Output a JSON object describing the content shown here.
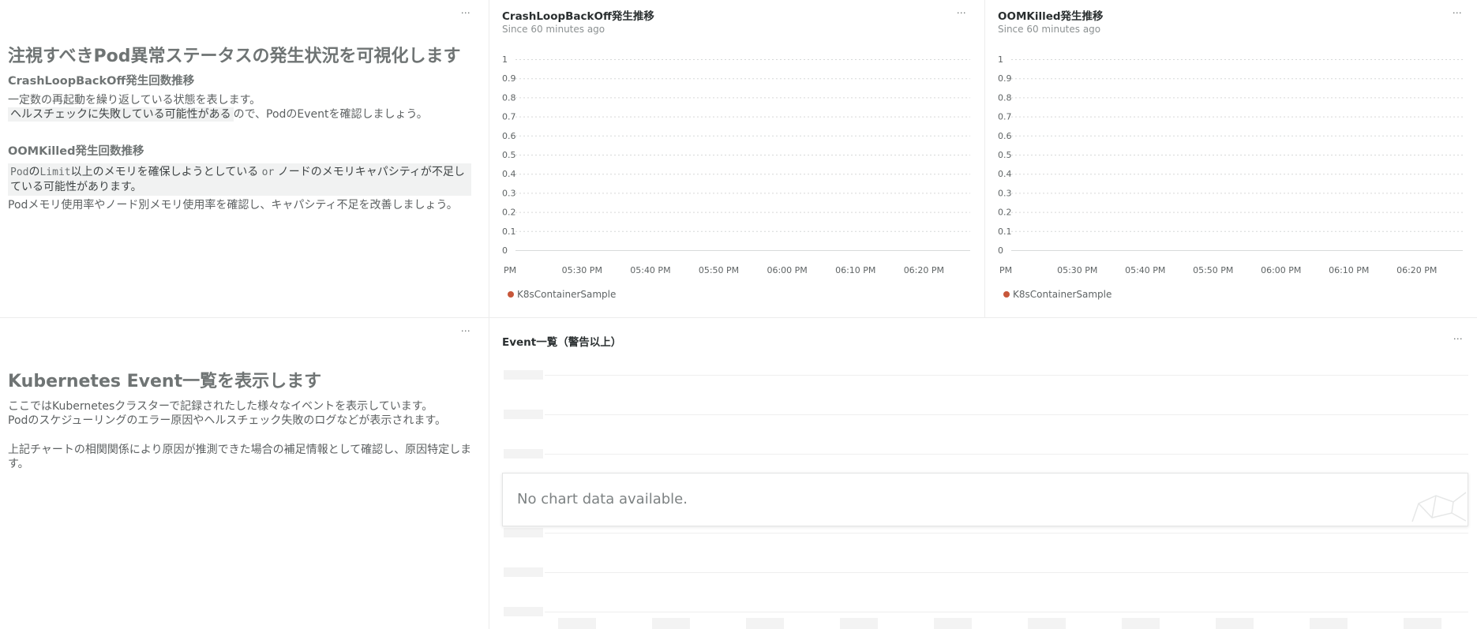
{
  "colors": {
    "series": "#c7573a",
    "accent": "#2a2f30",
    "muted": "#8c9192"
  },
  "menu_icon": "ellipsis-icon",
  "md_top": {
    "h1": "注視すべきPod異常ステータスの発生状況を可視化します",
    "s1_title": "CrashLoopBackOff発生回数推移",
    "s1_line1": "一定数の再起動を繰り返している状態を表します。",
    "s1_hl": "ヘルスチェックに失敗している可能性がある",
    "s1_rest": "ので、PodのEventを確認しましょう。",
    "s2_title": "OOMKilled発生回数推移",
    "s2_code1": "Pod",
    "s2_t1": "の",
    "s2_code2": "Limit",
    "s2_t2": "以上のメモリを確保しようとしている ",
    "s2_or": "or",
    "s2_t3": " ノードのメモリキャパシティが不足している可能性があります。",
    "s2_para": "Podメモリ使用率やノード別メモリ使用率を確認し、キャパシティ不足を改善しましょう。"
  },
  "chart1": {
    "title": "CrashLoopBackOff発生推移",
    "subtitle": "Since 60 minutes ago",
    "legend": "K8sContainerSample"
  },
  "chart2": {
    "title": "OOMKilled発生推移",
    "subtitle": "Since 60 minutes ago",
    "legend": "K8sContainerSample"
  },
  "chart_data": [
    {
      "type": "line",
      "title": "CrashLoopBackOff発生推移",
      "subtitle": "Since 60 minutes ago",
      "y_ticks": [
        "1",
        "0.9",
        "0.8",
        "0.7",
        "0.6",
        "0.5",
        "0.4",
        "0.3",
        "0.2",
        "0.1",
        "0"
      ],
      "x_ticks": [
        "PM",
        "05:30 PM",
        "05:40 PM",
        "05:50 PM",
        "06:00 PM",
        "06:10 PM",
        "06:20 PM"
      ],
      "ylim": [
        0,
        1
      ],
      "grid": true,
      "series": [
        {
          "name": "K8sContainerSample",
          "values": []
        }
      ],
      "legend": "bottom-left"
    },
    {
      "type": "line",
      "title": "OOMKilled発生推移",
      "subtitle": "Since 60 minutes ago",
      "y_ticks": [
        "1",
        "0.9",
        "0.8",
        "0.7",
        "0.6",
        "0.5",
        "0.4",
        "0.3",
        "0.2",
        "0.1",
        "0"
      ],
      "x_ticks": [
        "PM",
        "05:30 PM",
        "05:40 PM",
        "05:50 PM",
        "06:00 PM",
        "06:10 PM",
        "06:20 PM"
      ],
      "ylim": [
        0,
        1
      ],
      "grid": true,
      "series": [
        {
          "name": "K8sContainerSample",
          "values": []
        }
      ],
      "legend": "bottom-left"
    }
  ],
  "md_bottom": {
    "h1": "Kubernetes Event一覧を表示します",
    "p1": "ここではKubernetesクラスターで記録されたした様々なイベントを表示しています。",
    "p2": "Podのスケジューリングのエラー原因やヘルスチェック失敗のログなどが表示されます。",
    "p3": "上記チャートの相関関係により原因が推測できた場合の補足情報として確認し、原因特定します。"
  },
  "events": {
    "title": "Event一覧（警告以上）",
    "nodata": "No chart data available."
  }
}
